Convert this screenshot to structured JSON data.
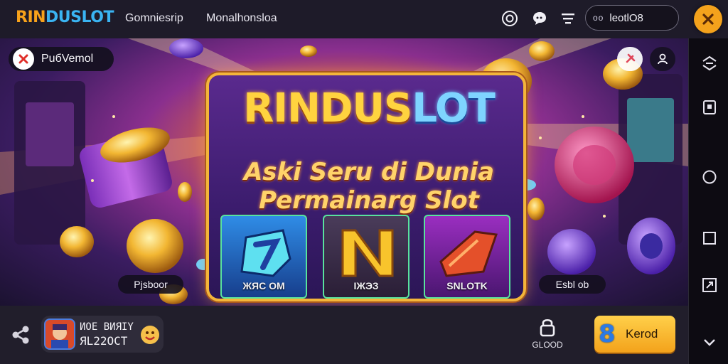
{
  "topbar": {
    "logo_prefix": "RIN",
    "logo_suffix": "DUSLOT",
    "nav_1": "Gomniesrip",
    "nav_2": "Monalhonsloa",
    "pill_dots": "oo",
    "pill_text": "leotlO8",
    "icons": [
      "target-icon",
      "chat-icon",
      "filter-icon",
      "close-icon"
    ]
  },
  "banner": {
    "user_chip": "PuбVemol",
    "title_main": "RINDUS",
    "title_accent": "LOT",
    "subtitle_1": "Aski Seru di Dunia",
    "subtitle_2": "Permainarg Slot",
    "cards": [
      {
        "label": "ЖЯС ОМ",
        "color": "#1f5fb8"
      },
      {
        "label": "IЖЭЗ",
        "color": "#3d2a4e"
      },
      {
        "label": "SNLOTK",
        "color": "#7a1f9a"
      }
    ],
    "caption_left": "Pjsboor",
    "caption_right": "Esbl ob"
  },
  "bottombar": {
    "game_line_1": "ИОЕ ВИЯIY",
    "game_line_2": "ЯL22ОСТ",
    "lock_label": "GLOOD",
    "play_number": "8",
    "play_label": "Kerod"
  },
  "colors": {
    "accent": "#f4a21c",
    "rail_bg": "#0d0b12",
    "card_border": "#58e39d"
  }
}
